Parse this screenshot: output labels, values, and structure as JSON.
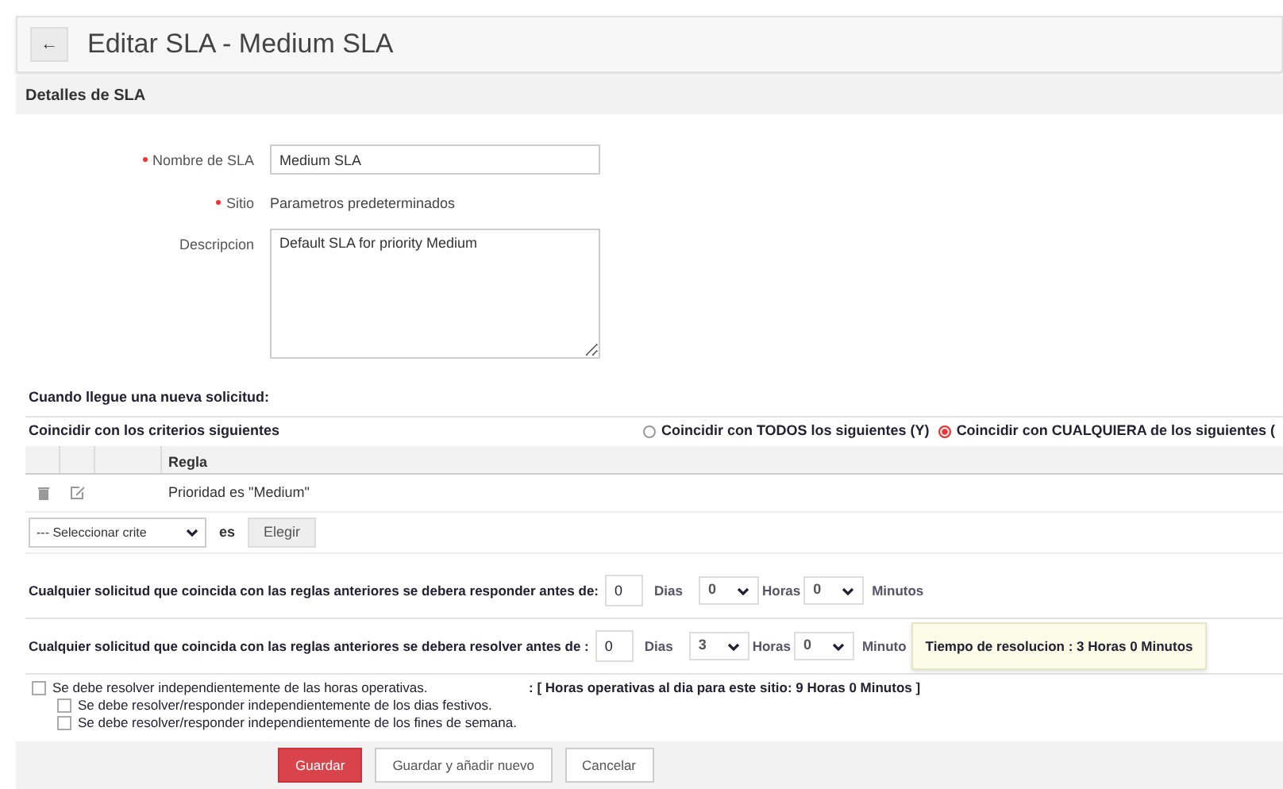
{
  "header": {
    "back_icon": "←",
    "title": "Editar SLA - Medium SLA"
  },
  "section_title": "Detalles de SLA",
  "fields": [
    {
      "kind": "input",
      "label": "Nombre de SLA",
      "required": true,
      "value": "Medium SLA"
    },
    {
      "kind": "text",
      "label": "Sitio",
      "required": true,
      "value": "Parametros predeterminados"
    },
    {
      "kind": "textarea",
      "label": "Descripcion",
      "required": false,
      "value": "Default SLA for priority Medium"
    }
  ],
  "rules_heading": "Cuando llegue una nueva solicitud:",
  "criteria": {
    "title": "Coincidir con los criterios siguientes",
    "match_options": [
      {
        "label": "Coincidir con TODOS los siguientes (Y)",
        "selected": false
      },
      {
        "label": "Coincidir con CUALQUIERA de los siguientes (",
        "selected": true
      }
    ],
    "columns": [
      "Regla"
    ],
    "rows": [
      {
        "rule": "Prioridad es \"Medium\""
      }
    ],
    "select": "--- Seleccionar crite",
    "select_suffix": "es",
    "choose_button": "Elegir"
  },
  "deadlines": [
    {
      "label": "Cualquier solicitud que coincida con las reglas anteriores se debera responder antes de:",
      "days": "0",
      "days_label": "Dias",
      "hours": "0",
      "hours_label": "Horas",
      "minutes": "0",
      "minutes_label": "Minutos"
    },
    {
      "label": "Cualquier solicitud que coincida con las reglas anteriores se debera resolver antes de  :",
      "days": "0",
      "days_label": "Dias",
      "hours": "3",
      "hours_label": "Horas",
      "minutes": "0",
      "minutes_label": "Minuto",
      "tooltip": "Tiempo de resolucion : 3 Horas 0 Minutos"
    }
  ],
  "options": [
    {
      "label": "Se debe resolver independientemente de las horas operativas.",
      "checked": false,
      "note": ": [ Horas operativas al dia para este sitio:  9 Horas 0 Minutos ]",
      "children": [
        {
          "label": "Se debe resolver/responder independientemente de los dias festivos.",
          "checked": false
        },
        {
          "label": "Se debe resolver/responder independientemente de los fines de semana.",
          "checked": false
        }
      ]
    }
  ],
  "buttons": [
    {
      "kind": "primary",
      "label": "Guardar"
    },
    {
      "kind": "secondary",
      "label": "Guardar y añadir nuevo"
    },
    {
      "kind": "secondary",
      "label": "Cancelar"
    }
  ]
}
